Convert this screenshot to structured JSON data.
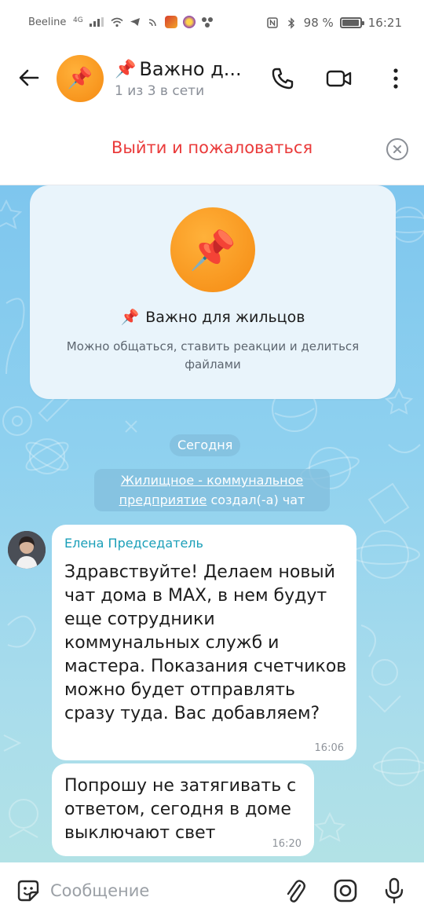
{
  "status_bar": {
    "carrier": "Beeline",
    "network": "4G",
    "battery_text": "98 %",
    "battery_level": 0.98,
    "time": "16:21"
  },
  "header": {
    "title_emoji": "📌",
    "title": "Важно д...",
    "subtitle": "1 из 3 в сети",
    "avatar_emoji": "📌"
  },
  "leave_bar": {
    "label": "Выйти и пожаловаться"
  },
  "info_card": {
    "avatar_emoji": "📌",
    "title_emoji": "📌",
    "title": "Важно для жильцов",
    "description": "Можно общаться, ставить реакции и делиться файлами"
  },
  "date_separator": "Сегодня",
  "service_message": {
    "link_text": "Жилищное - коммунальное предприятие",
    "text": " создал(-а) чат"
  },
  "messages": [
    {
      "sender": "Елена Председатель",
      "text": "Здравствуйте! Делаем новый чат дома в MAX, в нем будут еще сотрудники коммунальных служб и мастера. Показания счетчиков можно будет отправлять сразу туда. Вас добавляем?",
      "time": "16:06"
    },
    {
      "text": "Попрошу не затягивать с ответом, сегодня в доме выключают свет",
      "time": "16:20"
    }
  ],
  "input_bar": {
    "placeholder": "Сообщение"
  },
  "colors": {
    "accent_red": "#ea3a3a",
    "sender_name": "#1a9fb8",
    "avatar_orange": "#f58a12",
    "chat_bg": "#8fd1ef"
  },
  "icons": [
    "back-arrow-icon",
    "phone-icon",
    "video-camera-icon",
    "more-vertical-icon",
    "close-circle-icon",
    "sticker-icon",
    "paperclip-icon",
    "camera-icon",
    "microphone-icon"
  ]
}
